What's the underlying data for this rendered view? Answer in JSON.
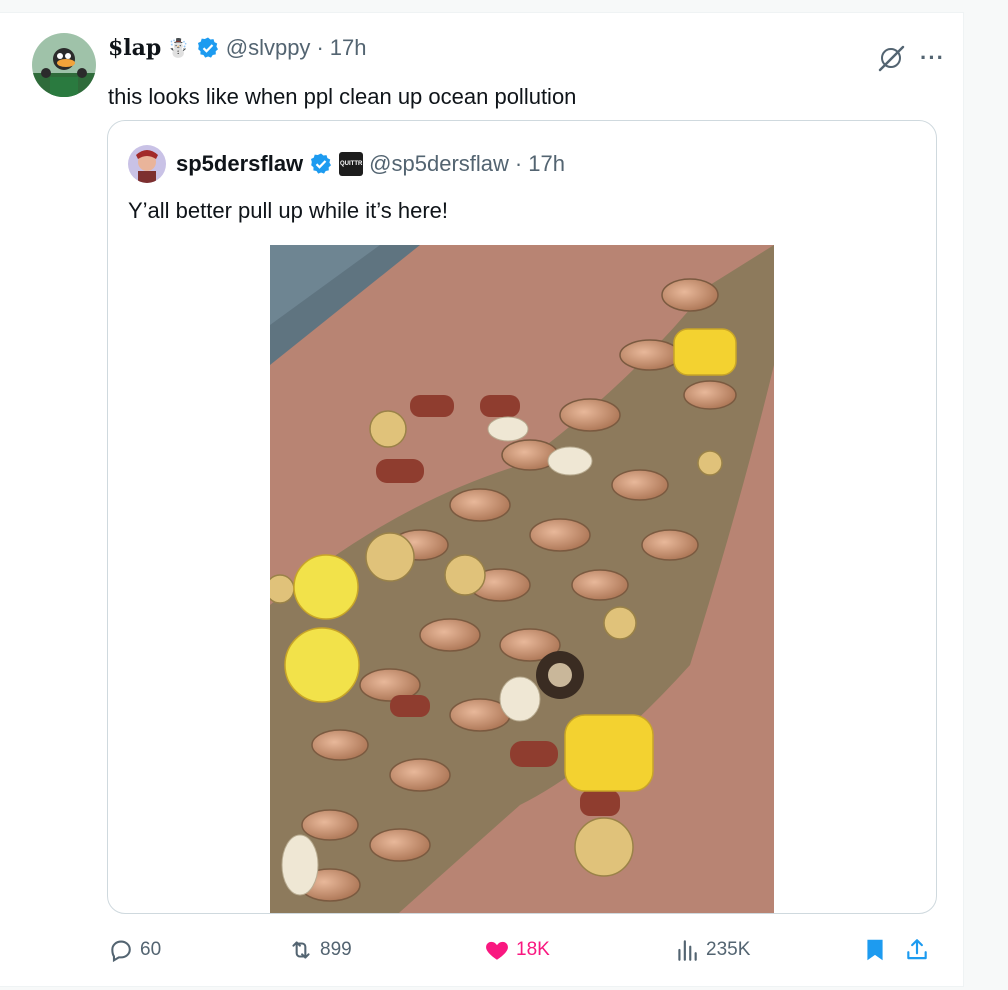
{
  "tweet": {
    "display_name": "$lap",
    "name_emoji": "☃️",
    "handle": "@slvppy",
    "separator": "·",
    "time": "17h",
    "text": "this looks like when ppl clean up ocean pollution",
    "verified": true
  },
  "quoted_tweet": {
    "display_name": "sp5dersflaw",
    "badge_text": "QUITTR",
    "handle": "@sp5dersflaw",
    "separator": "·",
    "time": "17h",
    "text": "Y’all better pull up while it’s here!",
    "verified": true,
    "image_description_icon": "photo-of-seafood-boil"
  },
  "actions": {
    "replies": "60",
    "retweets": "899",
    "likes": "18K",
    "views": "235K",
    "liked": true,
    "bookmarked": true
  },
  "colors": {
    "accent_blue": "#1d9bf0",
    "like_pink": "#f91880",
    "muted_text": "#536471",
    "border": "#cfd9de"
  }
}
